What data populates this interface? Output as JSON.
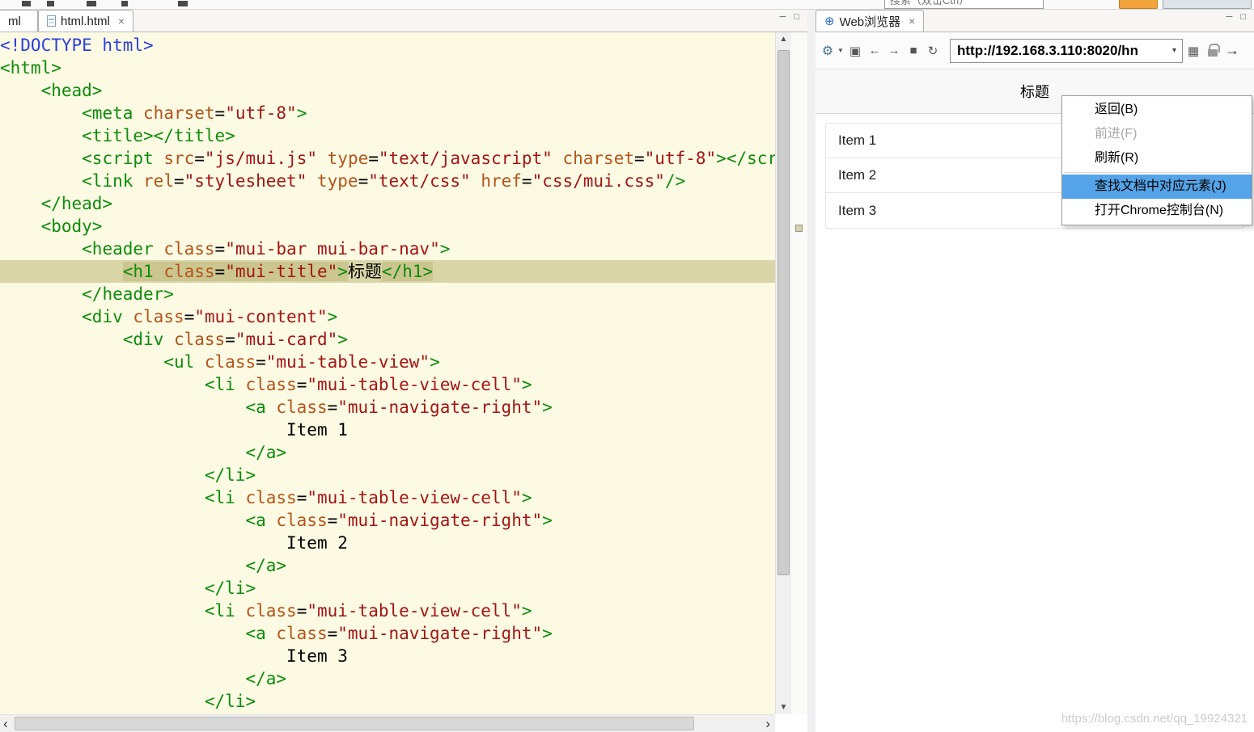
{
  "top_strip": {
    "search_placeholder": "搜索（双击Ctrl）"
  },
  "editor": {
    "partial_tab_label": "ml",
    "tab_label": "html.html",
    "tab_close": "×",
    "min_glyph": "─",
    "max_glyph": "□",
    "scroll_up_glyph": "▲",
    "scroll_down_glyph": "▼",
    "scroll_left_glyph": "‹",
    "scroll_right_glyph": "›",
    "code": {
      "highlight_line": 11,
      "lines": [
        [
          [
            "d",
            "<!DOCTYPE html>"
          ]
        ],
        [
          [
            "t",
            "<html>"
          ]
        ],
        [
          [
            "p",
            "\t"
          ],
          [
            "t",
            "<head>"
          ]
        ],
        [
          [
            "p",
            "\t\t"
          ],
          [
            "t",
            "<meta"
          ],
          [
            "p",
            " "
          ],
          [
            "a",
            "charset"
          ],
          [
            "p",
            "="
          ],
          [
            "s",
            "\"utf-8\""
          ],
          [
            "t",
            ">"
          ]
        ],
        [
          [
            "p",
            "\t\t"
          ],
          [
            "t",
            "<title></title>"
          ]
        ],
        [
          [
            "p",
            "\t\t"
          ],
          [
            "t",
            "<script"
          ],
          [
            "p",
            " "
          ],
          [
            "a",
            "src"
          ],
          [
            "p",
            "="
          ],
          [
            "s",
            "\"js/mui.js\""
          ],
          [
            "p",
            " "
          ],
          [
            "a",
            "type"
          ],
          [
            "p",
            "="
          ],
          [
            "s",
            "\"text/javascript\""
          ],
          [
            "p",
            " "
          ],
          [
            "a",
            "charset"
          ],
          [
            "p",
            "="
          ],
          [
            "s",
            "\"utf-8\""
          ],
          [
            "t",
            "></script>"
          ]
        ],
        [
          [
            "p",
            "\t\t"
          ],
          [
            "t",
            "<link"
          ],
          [
            "p",
            " "
          ],
          [
            "a",
            "rel"
          ],
          [
            "p",
            "="
          ],
          [
            "s",
            "\"stylesheet\""
          ],
          [
            "p",
            " "
          ],
          [
            "a",
            "type"
          ],
          [
            "p",
            "="
          ],
          [
            "s",
            "\"text/css\""
          ],
          [
            "p",
            " "
          ],
          [
            "a",
            "href"
          ],
          [
            "p",
            "="
          ],
          [
            "s",
            "\"css/mui.css\""
          ],
          [
            "t",
            "/>"
          ]
        ],
        [
          [
            "p",
            "\t"
          ],
          [
            "t",
            "</head>"
          ]
        ],
        [
          [
            "p",
            "\t"
          ],
          [
            "t",
            "<body>"
          ]
        ],
        [
          [
            "p",
            "\t\t"
          ],
          [
            "t",
            "<header"
          ],
          [
            "p",
            " "
          ],
          [
            "a",
            "class"
          ],
          [
            "p",
            "="
          ],
          [
            "s",
            "\"mui-bar mui-bar-nav\""
          ],
          [
            "t",
            ">"
          ]
        ],
        [
          [
            "p",
            "\t\t\t"
          ],
          [
            "t",
            "<h1",
            1
          ],
          [
            "p",
            " ",
            1
          ],
          [
            "a",
            "class",
            1
          ],
          [
            "p",
            "=",
            1
          ],
          [
            "s",
            "\"mui-title\"",
            1
          ],
          [
            "t",
            ">",
            1
          ],
          [
            "p",
            "标题"
          ],
          [
            "t",
            "</h1>",
            1
          ]
        ],
        [
          [
            "p",
            "\t\t"
          ],
          [
            "t",
            "</header>"
          ]
        ],
        [
          [
            "p",
            "\t\t"
          ],
          [
            "t",
            "<div"
          ],
          [
            "p",
            " "
          ],
          [
            "a",
            "class"
          ],
          [
            "p",
            "="
          ],
          [
            "s",
            "\"mui-content\""
          ],
          [
            "t",
            ">"
          ]
        ],
        [
          [
            "p",
            "\t\t\t"
          ],
          [
            "t",
            "<div"
          ],
          [
            "p",
            " "
          ],
          [
            "a",
            "class"
          ],
          [
            "p",
            "="
          ],
          [
            "s",
            "\"mui-card\""
          ],
          [
            "t",
            ">"
          ]
        ],
        [
          [
            "p",
            "\t\t\t\t"
          ],
          [
            "t",
            "<ul"
          ],
          [
            "p",
            " "
          ],
          [
            "a",
            "class"
          ],
          [
            "p",
            "="
          ],
          [
            "s",
            "\"mui-table-view\""
          ],
          [
            "t",
            ">"
          ]
        ],
        [
          [
            "p",
            "\t\t\t\t\t"
          ],
          [
            "t",
            "<li"
          ],
          [
            "p",
            " "
          ],
          [
            "a",
            "class"
          ],
          [
            "p",
            "="
          ],
          [
            "s",
            "\"mui-table-view-cell\""
          ],
          [
            "t",
            ">"
          ]
        ],
        [
          [
            "p",
            "\t\t\t\t\t\t"
          ],
          [
            "t",
            "<a"
          ],
          [
            "p",
            " "
          ],
          [
            "a",
            "class"
          ],
          [
            "p",
            "="
          ],
          [
            "s",
            "\"mui-navigate-right\""
          ],
          [
            "t",
            ">"
          ]
        ],
        [
          [
            "p",
            "\t\t\t\t\t\t\tItem 1"
          ]
        ],
        [
          [
            "p",
            "\t\t\t\t\t\t"
          ],
          [
            "t",
            "</a>"
          ]
        ],
        [
          [
            "p",
            "\t\t\t\t\t"
          ],
          [
            "t",
            "</li>"
          ]
        ],
        [
          [
            "p",
            "\t\t\t\t\t"
          ],
          [
            "t",
            "<li"
          ],
          [
            "p",
            " "
          ],
          [
            "a",
            "class"
          ],
          [
            "p",
            "="
          ],
          [
            "s",
            "\"mui-table-view-cell\""
          ],
          [
            "t",
            ">"
          ]
        ],
        [
          [
            "p",
            "\t\t\t\t\t\t"
          ],
          [
            "t",
            "<a"
          ],
          [
            "p",
            " "
          ],
          [
            "a",
            "class"
          ],
          [
            "p",
            "="
          ],
          [
            "s",
            "\"mui-navigate-right\""
          ],
          [
            "t",
            ">"
          ]
        ],
        [
          [
            "p",
            "\t\t\t\t\t\t\tItem 2"
          ]
        ],
        [
          [
            "p",
            "\t\t\t\t\t\t"
          ],
          [
            "t",
            "</a>"
          ]
        ],
        [
          [
            "p",
            "\t\t\t\t\t"
          ],
          [
            "t",
            "</li>"
          ]
        ],
        [
          [
            "p",
            "\t\t\t\t\t"
          ],
          [
            "t",
            "<li"
          ],
          [
            "p",
            " "
          ],
          [
            "a",
            "class"
          ],
          [
            "p",
            "="
          ],
          [
            "s",
            "\"mui-table-view-cell\""
          ],
          [
            "t",
            ">"
          ]
        ],
        [
          [
            "p",
            "\t\t\t\t\t\t"
          ],
          [
            "t",
            "<a"
          ],
          [
            "p",
            " "
          ],
          [
            "a",
            "class"
          ],
          [
            "p",
            "="
          ],
          [
            "s",
            "\"mui-navigate-right\""
          ],
          [
            "t",
            ">"
          ]
        ],
        [
          [
            "p",
            "\t\t\t\t\t\t\tItem 3"
          ]
        ],
        [
          [
            "p",
            "\t\t\t\t\t\t"
          ],
          [
            "t",
            "</a>"
          ]
        ],
        [
          [
            "p",
            "\t\t\t\t\t"
          ],
          [
            "t",
            "</li>"
          ]
        ]
      ]
    }
  },
  "browser": {
    "tab_icon": "⊕",
    "tab_label": "Web浏览器",
    "tab_close": "×",
    "min_glyph": "─",
    "max_glyph": "□",
    "toolbar": {
      "settings_glyph": "⚙",
      "settings_caret": "▼",
      "open_window_glyph": "▣",
      "back_glyph": "←",
      "forward_glyph": "→",
      "stop_glyph": "■",
      "refresh_glyph": "↻",
      "url": "http://192.168.3.110:8020/hn",
      "url_caret": "▾",
      "grid_glyph": "▦",
      "go_glyph": "→"
    },
    "page": {
      "header_title": "标题",
      "list_items": [
        "Item 1",
        "Item 2",
        "Item 3"
      ]
    },
    "context_menu": {
      "items": [
        {
          "label": "返回(B)",
          "state": "normal"
        },
        {
          "label": "前进(F)",
          "state": "disabled"
        },
        {
          "label": "刷新(R)",
          "state": "normal"
        },
        {
          "type": "separator"
        },
        {
          "label": "查找文档中对应元素(J)",
          "state": "highlighted"
        },
        {
          "label": "打开Chrome控制台(N)",
          "state": "normal"
        }
      ]
    }
  },
  "watermark": "https://blog.csdn.net/qq_19924321",
  "colors": {
    "editor_background": "#FCFAE3",
    "current_line_highlight": "#D9D5A7",
    "tag_color": "#0E8C0E",
    "attribute_color": "#B5541C",
    "string_color": "#A31515",
    "doctype_color": "#2B3FE0",
    "menu_highlight": "#55A3E8"
  }
}
